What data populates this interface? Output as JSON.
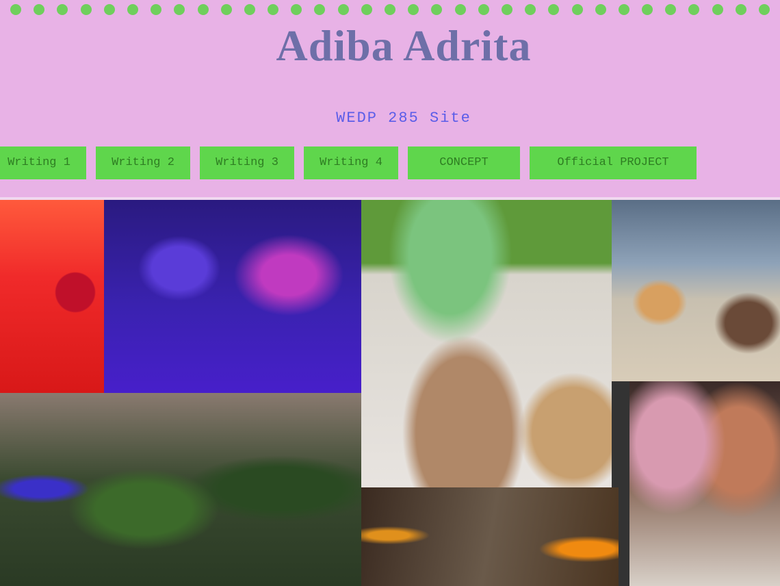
{
  "header": {
    "title": "Adiba Adrita",
    "subtitle": "WEDP 285 Site"
  },
  "nav": {
    "items": [
      {
        "label": "Writing 1"
      },
      {
        "label": "Writing 2"
      },
      {
        "label": "Writing 3"
      },
      {
        "label": "Writing 4"
      },
      {
        "label": "CONCEPT"
      },
      {
        "label": "Official PROJECT"
      }
    ]
  },
  "colors": {
    "page_background": "#e8b2e6",
    "nav_button": "#5fd64c",
    "title_text": "#6e6fa8",
    "subtitle_text": "#5b5de8",
    "dot_border": "#6fcf5c"
  }
}
